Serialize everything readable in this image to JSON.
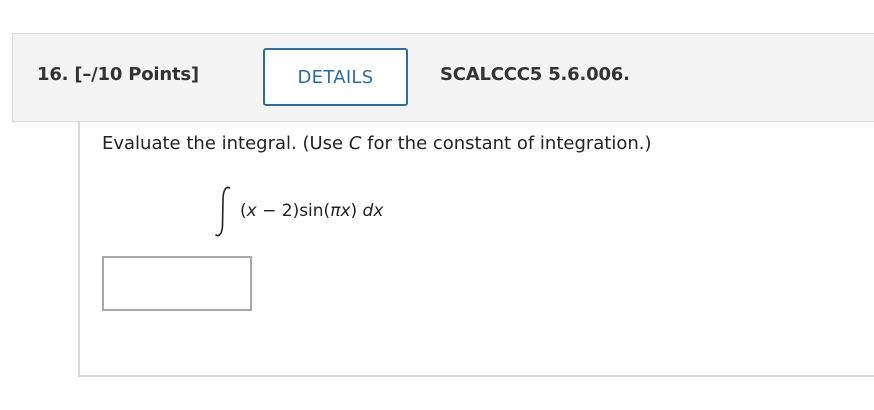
{
  "question": {
    "number_label": "16. [–/10 Points]",
    "details_button_label": "DETAILS",
    "assignment_code": "SCALCCC5 5.6.006."
  },
  "prompt": {
    "before_var": "Evaluate the integral. (Use ",
    "var": "C",
    "after_var": " for the constant of integration.)"
  },
  "integral": {
    "sign": "∫",
    "paren_open": "(",
    "x1": "x",
    "minus_two": " − 2)sin(",
    "pi_x": "πx",
    "paren_close": ") ",
    "dx": "dx"
  },
  "answer": {
    "value": "",
    "placeholder": ""
  },
  "colors": {
    "accent": "#2e6da4",
    "header_bg": "#f4f4f4",
    "border": "#d9d9d9"
  }
}
